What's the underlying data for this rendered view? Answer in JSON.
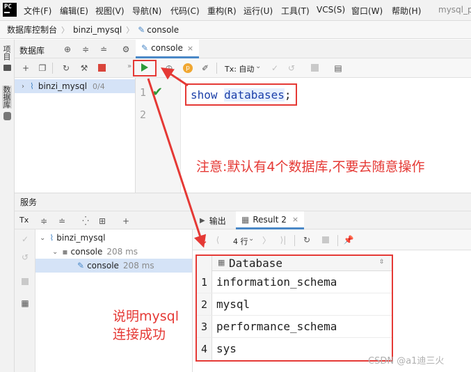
{
  "menu": {
    "items": [
      "文件(F)",
      "编辑(E)",
      "视图(V)",
      "导航(N)",
      "代码(C)",
      "重构(R)",
      "运行(U)",
      "工具(T)",
      "VCS(S)",
      "窗口(W)",
      "帮助(H)"
    ],
    "logo": "PC",
    "window_title": "mysql_p"
  },
  "breadcrumb": [
    "数据库控制台",
    "binzi_mysql",
    "console"
  ],
  "left_strip": {
    "project_tab": "项目",
    "database_tab": "数据库"
  },
  "db_panel": {
    "title": "数据库",
    "tree": {
      "name": "binzi_mysql",
      "count": "0/4"
    }
  },
  "editor": {
    "tab_label": "console",
    "tx_mode": "Tx: 自动",
    "line_numbers": [
      "1",
      "2"
    ],
    "code": {
      "keyword": "show",
      "object": "databases",
      "terminator": ";"
    }
  },
  "annotations": {
    "note": "注意:默认有4个数据库,不要去随意操作",
    "success_line1": "说明mysql",
    "success_line2": "连接成功"
  },
  "services": {
    "title": "服务",
    "tx_label": "Tx",
    "tree": {
      "root": "binzi_mysql",
      "session": {
        "name": "console",
        "time": "208 ms"
      },
      "child": {
        "name": "console",
        "time": "208 ms"
      }
    }
  },
  "results": {
    "tab_output": "输出",
    "tab_result": "Result 2",
    "row_count": "4 行",
    "column": "Database",
    "rows": [
      {
        "num": "1",
        "value": "information_schema"
      },
      {
        "num": "2",
        "value": "mysql"
      },
      {
        "num": "3",
        "value": "performance_schema"
      },
      {
        "num": "4",
        "value": "sys"
      }
    ]
  },
  "watermark": "CSDN @a1迪三火",
  "colors": {
    "accent_red": "#e53935",
    "run_green": "#2e9b3a",
    "tab_blue": "#4a88c7",
    "selected_row": "#d5e3f7"
  }
}
